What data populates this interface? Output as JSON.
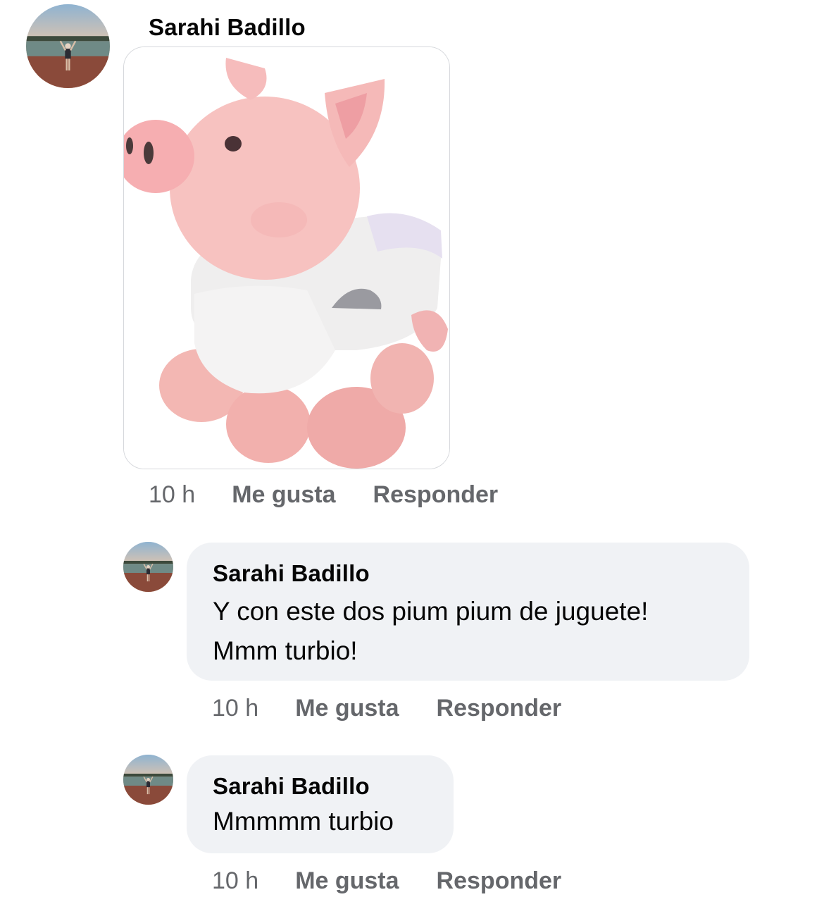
{
  "comments": [
    {
      "author": "Sarahi Badillo",
      "attachment": "pink-pig-plush-image",
      "time": "10 h",
      "like_label": "Me gusta",
      "reply_label": "Responder"
    }
  ],
  "replies": [
    {
      "author": "Sarahi Badillo",
      "text_line1": "Y con este dos pium pium de juguete!",
      "text_line2": "Mmm turbio!",
      "time": "10 h",
      "like_label": "Me gusta",
      "reply_label": "Responder"
    },
    {
      "author": "Sarahi Badillo",
      "text_line1": "Mmmmm turbio",
      "time": "10 h",
      "like_label": "Me gusta",
      "reply_label": "Responder"
    }
  ],
  "colors": {
    "bubble_bg": "#f0f2f5",
    "meta_text": "#65676b",
    "name_text": "#050505"
  }
}
